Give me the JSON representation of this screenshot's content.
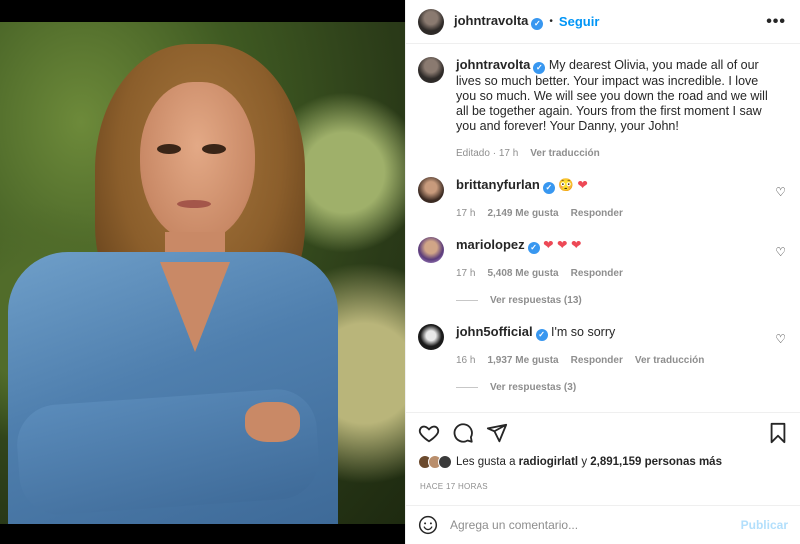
{
  "post_author": {
    "username": "johntravolta",
    "verified": true,
    "follow_label": "Seguir",
    "more_label": "•••"
  },
  "caption": {
    "username": "johntravolta",
    "text": "My dearest Olivia, you made all of our lives so much better. Your impact was incredible. I love you so much. We will see you down the road and we will all be together again. Yours from the first moment I saw you and forever! Your Danny, your John!",
    "edited_label": "Editado",
    "time": "17 h",
    "translate_label": "Ver traducción"
  },
  "comments": [
    {
      "username": "brittanyfurlan",
      "verified": true,
      "text": "😳",
      "hearts": "❤",
      "time": "17 h",
      "likes": "2,149 Me gusta",
      "reply_label": "Responder"
    },
    {
      "username": "mariolopez",
      "verified": true,
      "text": "",
      "hearts": "❤ ❤ ❤",
      "time": "17 h",
      "likes": "5,408 Me gusta",
      "reply_label": "Responder",
      "view_replies": "Ver respuestas (13)"
    },
    {
      "username": "john5official",
      "verified": true,
      "text": "I'm so sorry",
      "time": "16 h",
      "likes": "1,937 Me gusta",
      "reply_label": "Responder",
      "translate_label": "Ver traducción",
      "view_replies": "Ver respuestas (3)"
    }
  ],
  "likes_summary": {
    "prefix": "Les gusta a",
    "user": "radiogirlatl",
    "conjunction": "y",
    "others": "2,891,159 personas más"
  },
  "timestamp": "HACE 17 HORAS",
  "comment_box": {
    "placeholder": "Agrega un comentario...",
    "publish_label": "Publicar"
  },
  "icons": {
    "like": "heart-icon",
    "comment": "comment-icon",
    "share": "paper-plane-icon",
    "save": "bookmark-icon",
    "emoji": "emoji-icon"
  },
  "colors": {
    "accent": "#0095f6",
    "verified": "#3897f0",
    "heart_red": "#ed4956",
    "muted_text": "#8e8e8e"
  }
}
